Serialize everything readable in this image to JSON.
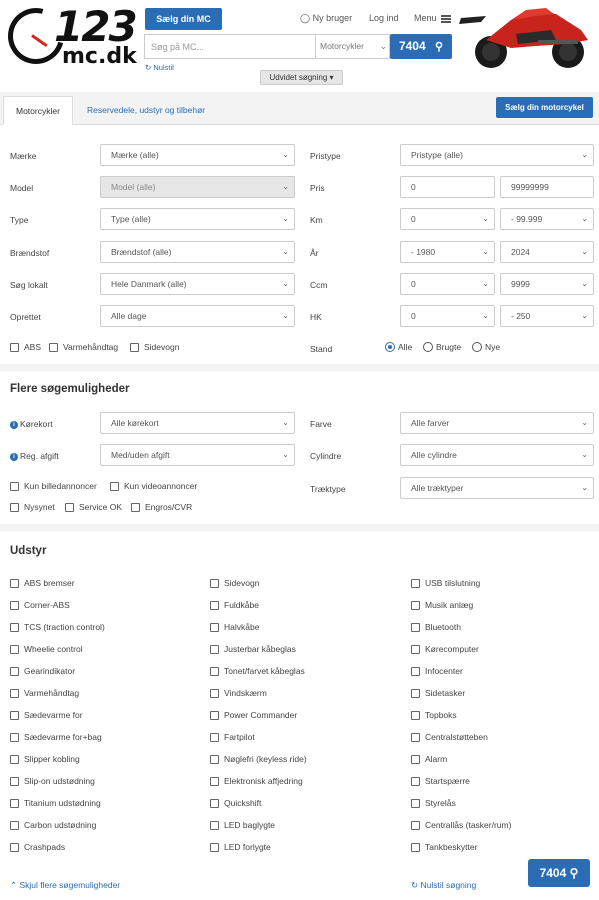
{
  "header": {
    "logo_number": "123",
    "logo_domain": "mc.dk",
    "sell_label": "Sælg din MC",
    "new_user": "Ny bruger",
    "login": "Log ind",
    "menu": "Menu",
    "search_placeholder": "Søg på MC...",
    "category": "Motorcykler",
    "result_count": "7404",
    "reset": "Nulstil",
    "advanced": "Udvidet søgning"
  },
  "tabs": {
    "active": "Motorcykler",
    "inactive": "Reservedele, udstyr og tilbehør",
    "sell_button": "Sælg din motorcykel"
  },
  "filters": {
    "left": [
      {
        "label": "Mærke",
        "value": "Mærke (alle)"
      },
      {
        "label": "Model",
        "value": "Model (alle)"
      },
      {
        "label": "Type",
        "value": "Type (alle)"
      },
      {
        "label": "Brændstof",
        "value": "Brændstof (alle)"
      },
      {
        "label": "Søg lokalt",
        "value": "Hele Danmark (alle)"
      },
      {
        "label": "Oprettet",
        "value": "Alle dage"
      }
    ],
    "right": [
      {
        "label": "Pristype",
        "value": "Pristype (alle)"
      },
      {
        "label": "Pris",
        "from": "0",
        "to": "99999999"
      },
      {
        "label": "Km",
        "from": "0",
        "to": "- 99.999"
      },
      {
        "label": "År",
        "from": "- 1980",
        "to": "2024"
      },
      {
        "label": "Ccm",
        "from": "0",
        "to": "9999"
      },
      {
        "label": "HK",
        "from": "0",
        "to": "- 250"
      }
    ],
    "checkboxes": [
      "ABS",
      "Varmehåndtag",
      "Sidevogn"
    ],
    "stand_label": "Stand",
    "stand_options": [
      "Alle",
      "Brugte",
      "Nye"
    ]
  },
  "more": {
    "title": "Flere søgemuligheder",
    "left": [
      {
        "label": "Kørekort",
        "value": "Alle kørekort"
      },
      {
        "label": "Reg. afgift",
        "value": "Med/uden afgift"
      }
    ],
    "right": [
      {
        "label": "Farve",
        "value": "Alle farver"
      },
      {
        "label": "Cylindre",
        "value": "Alle cylindre"
      },
      {
        "label": "Træktype",
        "value": "Alle træktyper"
      }
    ],
    "checkboxes_row1": [
      "Kun billedannoncer",
      "Kun videoannoncer"
    ],
    "checkboxes_row2": [
      "Nysynet",
      "Service OK",
      "Engros/CVR"
    ]
  },
  "equipment": {
    "title": "Udstyr",
    "col1": [
      "ABS bremser",
      "Corner-ABS",
      "TCS (traction control)",
      "Wheelie control",
      "Gearindikator",
      "Varmehåndtag",
      "Sædevarme for",
      "Sædevarme for+bag",
      "Slipper kobling",
      "Slip-on udstødning",
      "Titanium udstødning",
      "Carbon udstødning",
      "Crashpads"
    ],
    "col2": [
      "Sidevogn",
      "Fuldkåbe",
      "Halvkåbe",
      "Justerbar kåbeglas",
      "Tonet/farvet kåbeglas",
      "Vindskærm",
      "Power Commander",
      "Fartpilot",
      "Nøglefri (keyless ride)",
      "Elektronisk affjedring",
      "Quickshift",
      "LED baglygte",
      "LED forlygte"
    ],
    "col3": [
      "USB tilslutning",
      "Musik anlæg",
      "Bluetooth",
      "Kørecomputer",
      "Infocenter",
      "Sidetasker",
      "Topboks",
      "Centralstøtteben",
      "Alarm",
      "Startspærre",
      "Styrelås",
      "Centrallås (tasker/rum)",
      "Tankbeskytter"
    ]
  },
  "footer": {
    "hide": "Skjul flere søgemuligheder",
    "reset": "Nulstil søgning",
    "count": "7404"
  },
  "colors": {
    "accent": "#2a6db5",
    "brand_red": "#d5281f"
  }
}
